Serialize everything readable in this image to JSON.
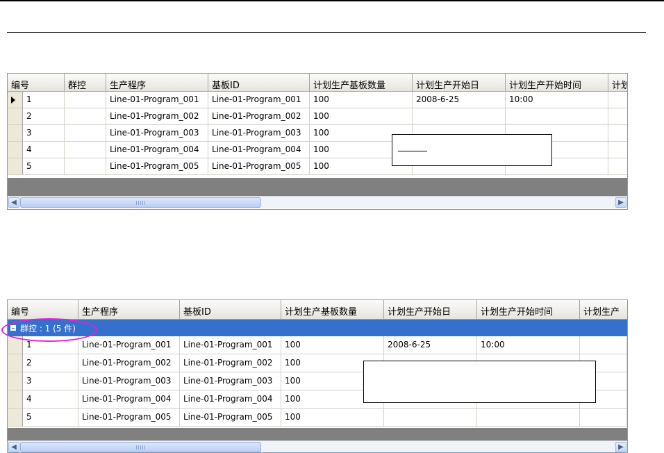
{
  "grid1": {
    "columns": [
      "编号",
      "群控",
      "生产程序",
      "基板ID",
      "计划生产基板数量",
      "计划生产开始日",
      "计划生产开始时间",
      "计划"
    ],
    "rows": [
      {
        "no": "1",
        "group": "",
        "program": "Line-01-Program_001",
        "board": "Line-01-Program_001",
        "qty": "100",
        "start_date": "2008-6-25",
        "start_time": "10:00"
      },
      {
        "no": "2",
        "group": "",
        "program": "Line-01-Program_002",
        "board": "Line-01-Program_002",
        "qty": "100",
        "start_date": "",
        "start_time": ""
      },
      {
        "no": "3",
        "group": "",
        "program": "Line-01-Program_003",
        "board": "Line-01-Program_003",
        "qty": "100",
        "start_date": "",
        "start_time": ""
      },
      {
        "no": "4",
        "group": "",
        "program": "Line-01-Program_004",
        "board": "Line-01-Program_004",
        "qty": "100",
        "start_date": "",
        "start_time": ""
      },
      {
        "no": "5",
        "group": "",
        "program": "Line-01-Program_005",
        "board": "Line-01-Program_005",
        "qty": "100",
        "start_date": "",
        "start_time": ""
      }
    ]
  },
  "grid2": {
    "columns": [
      "编号",
      "生产程序",
      "基板ID",
      "计划生产基板数量",
      "计划生产开始日",
      "计划生产开始时间",
      "计划生产"
    ],
    "group_label": "群控 : 1 (5 件)",
    "rows": [
      {
        "no": "1",
        "program": "Line-01-Program_001",
        "board": "Line-01-Program_001",
        "qty": "100",
        "start_date": "2008-6-25",
        "start_time": "10:00"
      },
      {
        "no": "2",
        "program": "Line-01-Program_002",
        "board": "Line-01-Program_002",
        "qty": "100",
        "start_date": "",
        "start_time": ""
      },
      {
        "no": "3",
        "program": "Line-01-Program_003",
        "board": "Line-01-Program_003",
        "qty": "100",
        "start_date": "",
        "start_time": ""
      },
      {
        "no": "4",
        "program": "Line-01-Program_004",
        "board": "Line-01-Program_004",
        "qty": "100",
        "start_date": "",
        "start_time": ""
      },
      {
        "no": "5",
        "program": "Line-01-Program_005",
        "board": "Line-01-Program_005",
        "qty": "100",
        "start_date": "",
        "start_time": ""
      }
    ]
  },
  "icons": {
    "scroll_left": "◀",
    "scroll_right": "▶",
    "current_row": "row-pointer-icon",
    "collapse": "minus-icon"
  },
  "colors": {
    "group_bar": "#3470cc",
    "highlight_ellipse": "#e61ee0",
    "grid_border": "#7f9db9"
  }
}
